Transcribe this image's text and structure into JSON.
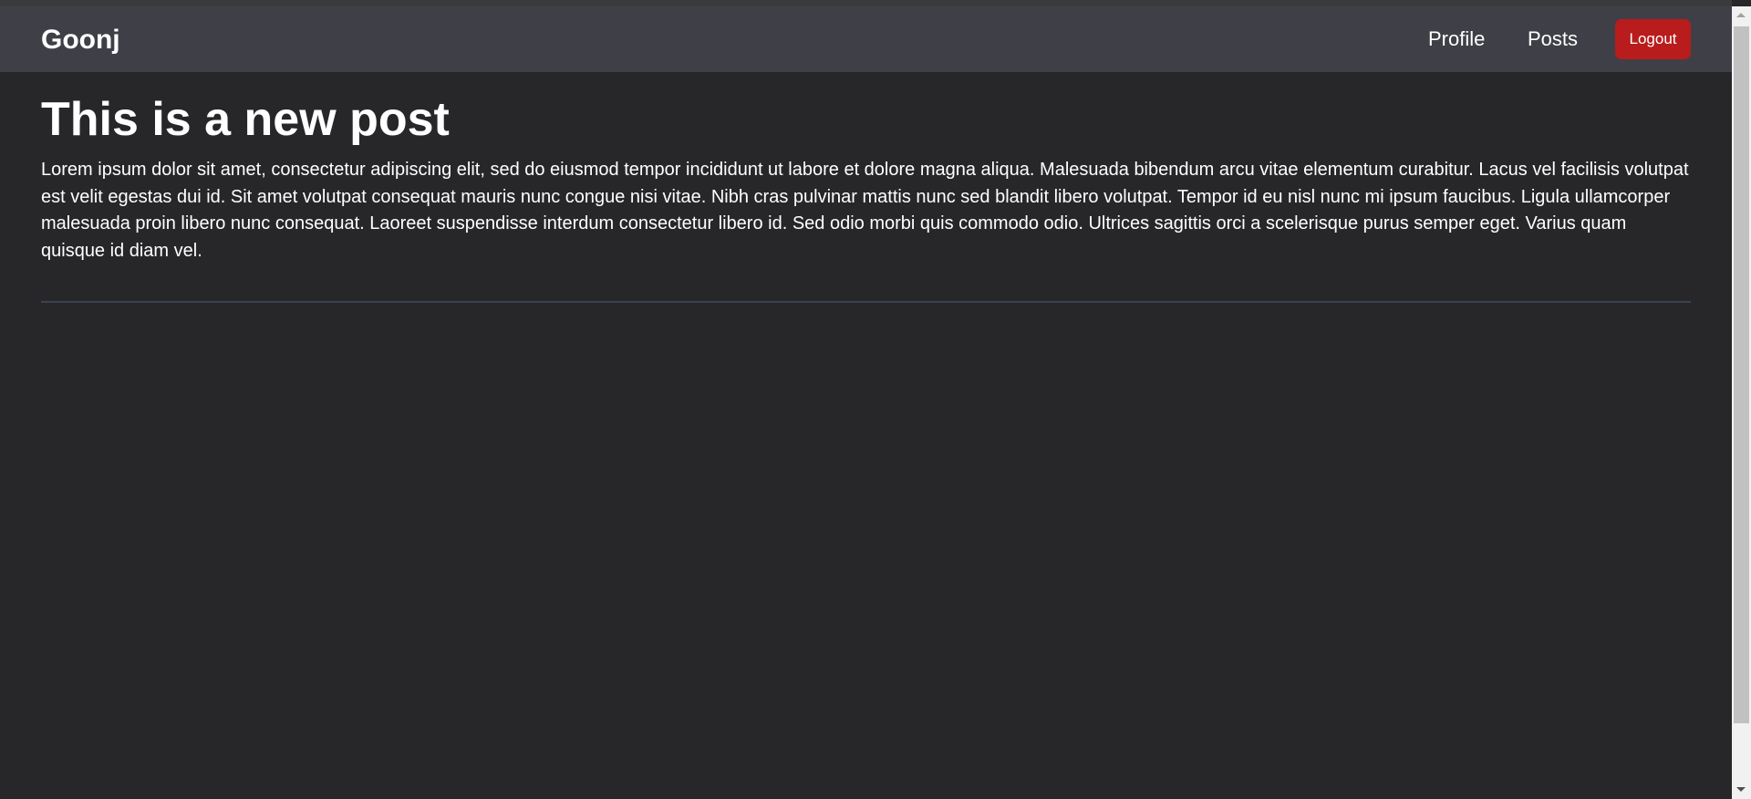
{
  "navbar": {
    "brand": "Goonj",
    "links": [
      {
        "label": "Profile"
      },
      {
        "label": "Posts"
      }
    ],
    "logout_label": "Logout",
    "logout_color": "#b91c1c"
  },
  "post": {
    "title": "This is a new post",
    "body": "Lorem ipsum dolor sit amet, consectetur adipiscing elit, sed do eiusmod tempor incididunt ut labore et dolore magna aliqua. Malesuada bibendum arcu vitae elementum curabitur. Lacus vel facilisis volutpat est velit egestas dui id. Sit amet volutpat consequat mauris nunc congue nisi vitae. Nibh cras pulvinar mattis nunc sed blandit libero volutpat. Tempor id eu nisl nunc mi ipsum faucibus. Ligula ullamcorper malesuada proin libero nunc consequat. Laoreet suspendisse interdum consectetur libero id. Sed odio morbi quis commodo odio. Ultrices sagittis orci a scelerisque purus semper eget. Varius quam quisque id diam vel."
  }
}
